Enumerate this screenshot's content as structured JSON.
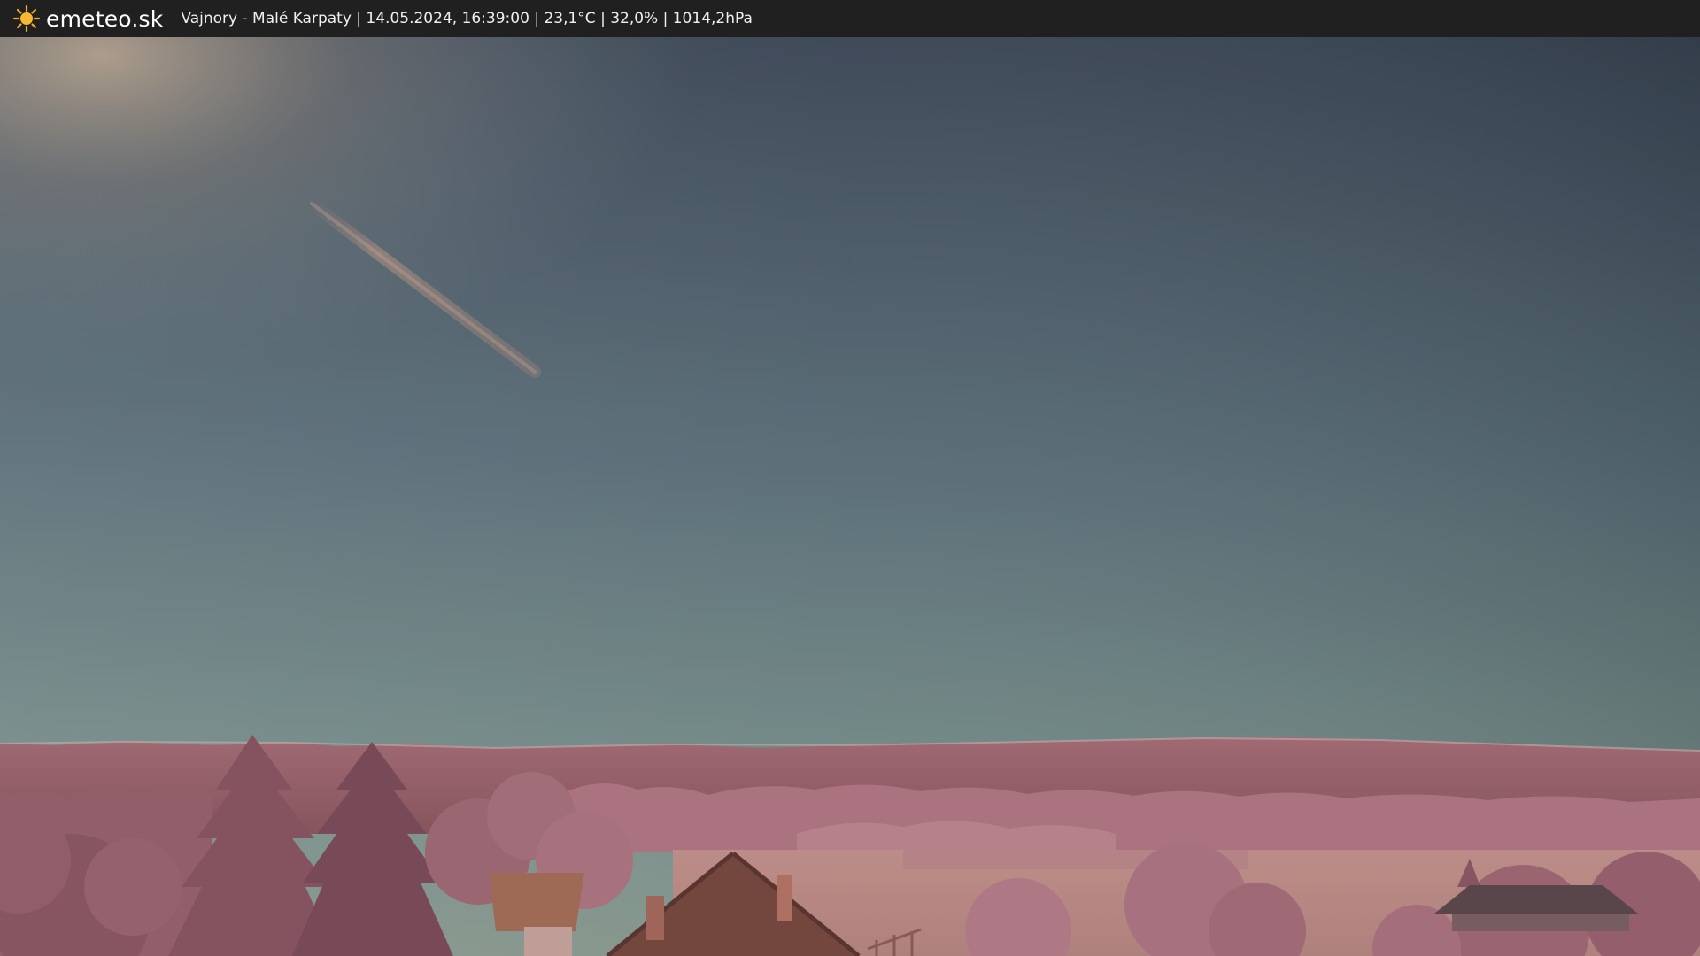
{
  "header": {
    "brand": "emeteo.sk",
    "caption": "Vajnory - Malé Karpaty | 14.05.2024, 16:39:00 | 23,1°C | 32,0% | 1014,2hPa",
    "logo_icon": "sun-icon",
    "bar_color": "#202020",
    "sun_color": "#f5a623"
  },
  "scene": {
    "sky_top": "#3a4654",
    "sky_horizon": "#7d9691",
    "foliage": "#b27786",
    "ground": "#c9948f"
  }
}
